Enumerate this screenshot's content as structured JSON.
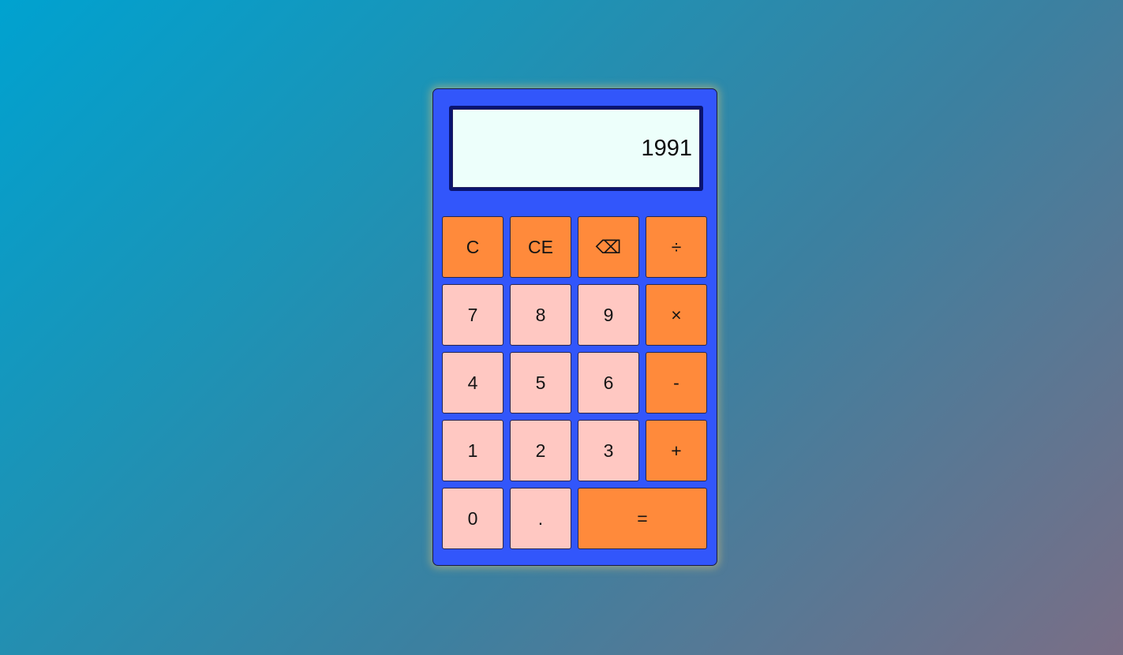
{
  "display": {
    "value": "1991"
  },
  "keys": [
    {
      "label": "C",
      "name": "clear-button",
      "kind": "op"
    },
    {
      "label": "CE",
      "name": "clear-entry-button",
      "kind": "op"
    },
    {
      "label": "⌫",
      "name": "backspace-button",
      "kind": "op"
    },
    {
      "label": "÷",
      "name": "divide-button",
      "kind": "op"
    },
    {
      "label": "7",
      "name": "digit-7-button",
      "kind": "num"
    },
    {
      "label": "8",
      "name": "digit-8-button",
      "kind": "num"
    },
    {
      "label": "9",
      "name": "digit-9-button",
      "kind": "num"
    },
    {
      "label": "×",
      "name": "multiply-button",
      "kind": "op"
    },
    {
      "label": "4",
      "name": "digit-4-button",
      "kind": "num"
    },
    {
      "label": "5",
      "name": "digit-5-button",
      "kind": "num"
    },
    {
      "label": "6",
      "name": "digit-6-button",
      "kind": "num"
    },
    {
      "label": "-",
      "name": "subtract-button",
      "kind": "op"
    },
    {
      "label": "1",
      "name": "digit-1-button",
      "kind": "num"
    },
    {
      "label": "2",
      "name": "digit-2-button",
      "kind": "num"
    },
    {
      "label": "3",
      "name": "digit-3-button",
      "kind": "num"
    },
    {
      "label": "+",
      "name": "add-button",
      "kind": "op"
    },
    {
      "label": "0",
      "name": "digit-0-button",
      "kind": "num"
    },
    {
      "label": ".",
      "name": "decimal-point-button",
      "kind": "num"
    },
    {
      "label": "=",
      "name": "equals-button",
      "kind": "op",
      "wide": true
    }
  ],
  "colors": {
    "body": "#3256fb",
    "operator_key": "#ff8a3b",
    "number_key": "#ffc8c2",
    "display_bg": "#edfffb",
    "display_border": "#0a1470"
  }
}
